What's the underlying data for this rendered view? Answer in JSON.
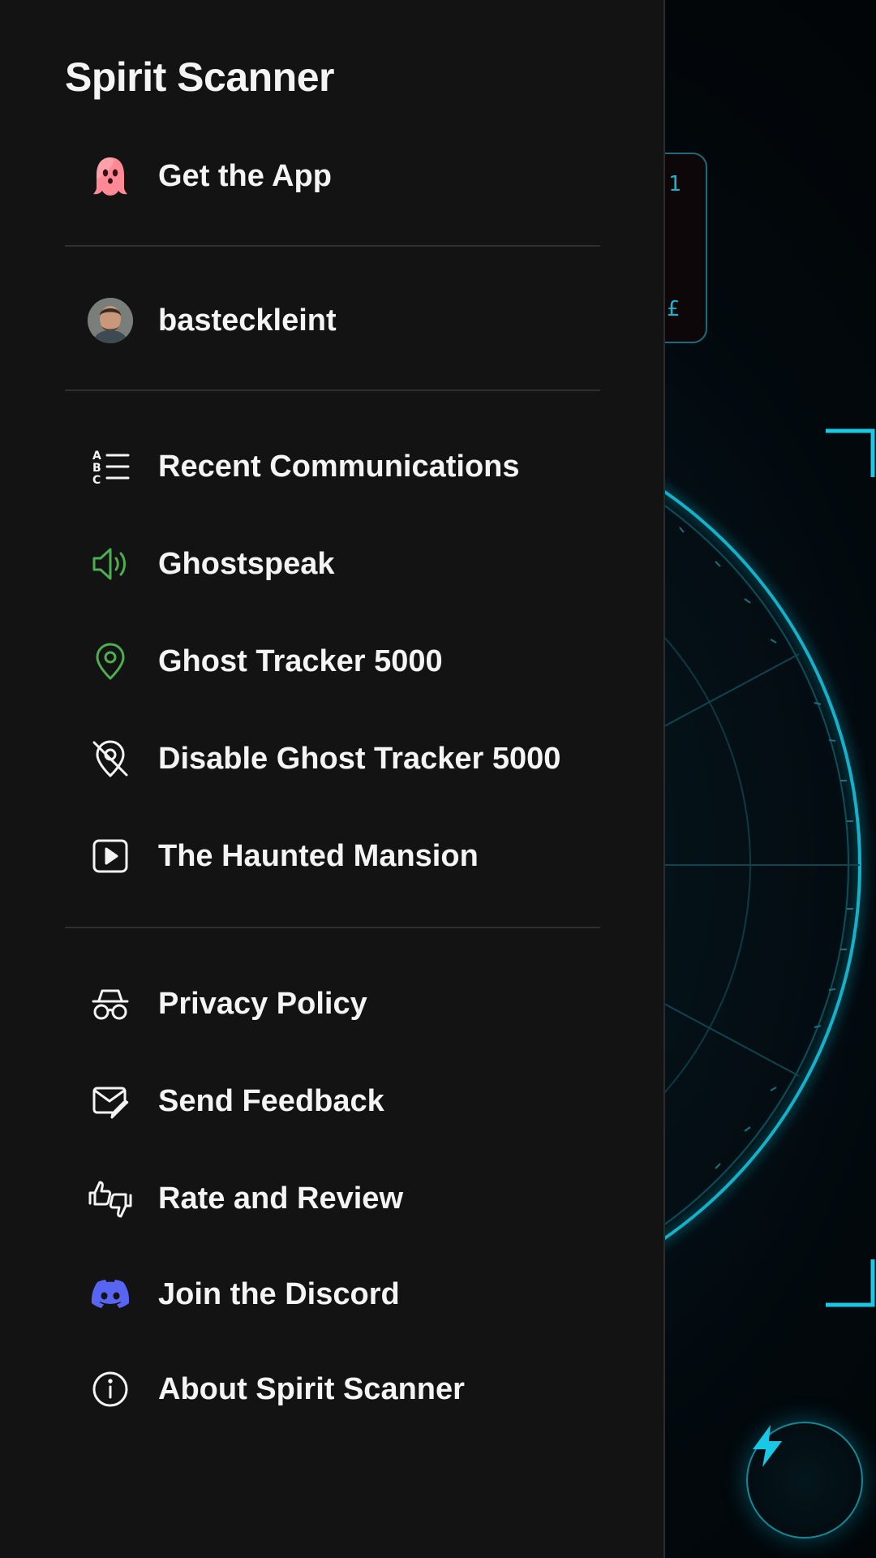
{
  "app_title": "Spirit Scanner",
  "colors": {
    "drawer_bg": "#131313",
    "accent_green": "#4caf50",
    "accent_cyan": "#18c8e4",
    "discord_blue": "#5865f2",
    "ghost_pink": "#ff7b8a"
  },
  "menu": {
    "get_app": {
      "label": "Get the App",
      "icon": "ghost-icon"
    },
    "account": {
      "label": "basteckleint",
      "icon": "avatar"
    },
    "primary": [
      {
        "label": "Recent Communications",
        "icon": "abc-list-icon"
      },
      {
        "label": "Ghostspeak",
        "icon": "speaker-icon"
      },
      {
        "label": "Ghost Tracker 5000",
        "icon": "location-pin-icon"
      },
      {
        "label": "Disable Ghost Tracker 5000",
        "icon": "location-off-icon"
      },
      {
        "label": "The Haunted Mansion",
        "icon": "play-icon"
      }
    ],
    "secondary": [
      {
        "label": "Privacy Policy",
        "icon": "incognito-icon"
      },
      {
        "label": "Send Feedback",
        "icon": "mail-edit-icon"
      },
      {
        "label": "Rate and Review",
        "icon": "thumbs-icon"
      },
      {
        "label": "Join the Discord",
        "icon": "discord-icon"
      },
      {
        "label": "About Spirit Scanner",
        "icon": "info-icon"
      }
    ]
  },
  "scanner": {
    "readout_top": "1",
    "readout_bottom": "£",
    "flash_icon": "lightning-icon"
  }
}
